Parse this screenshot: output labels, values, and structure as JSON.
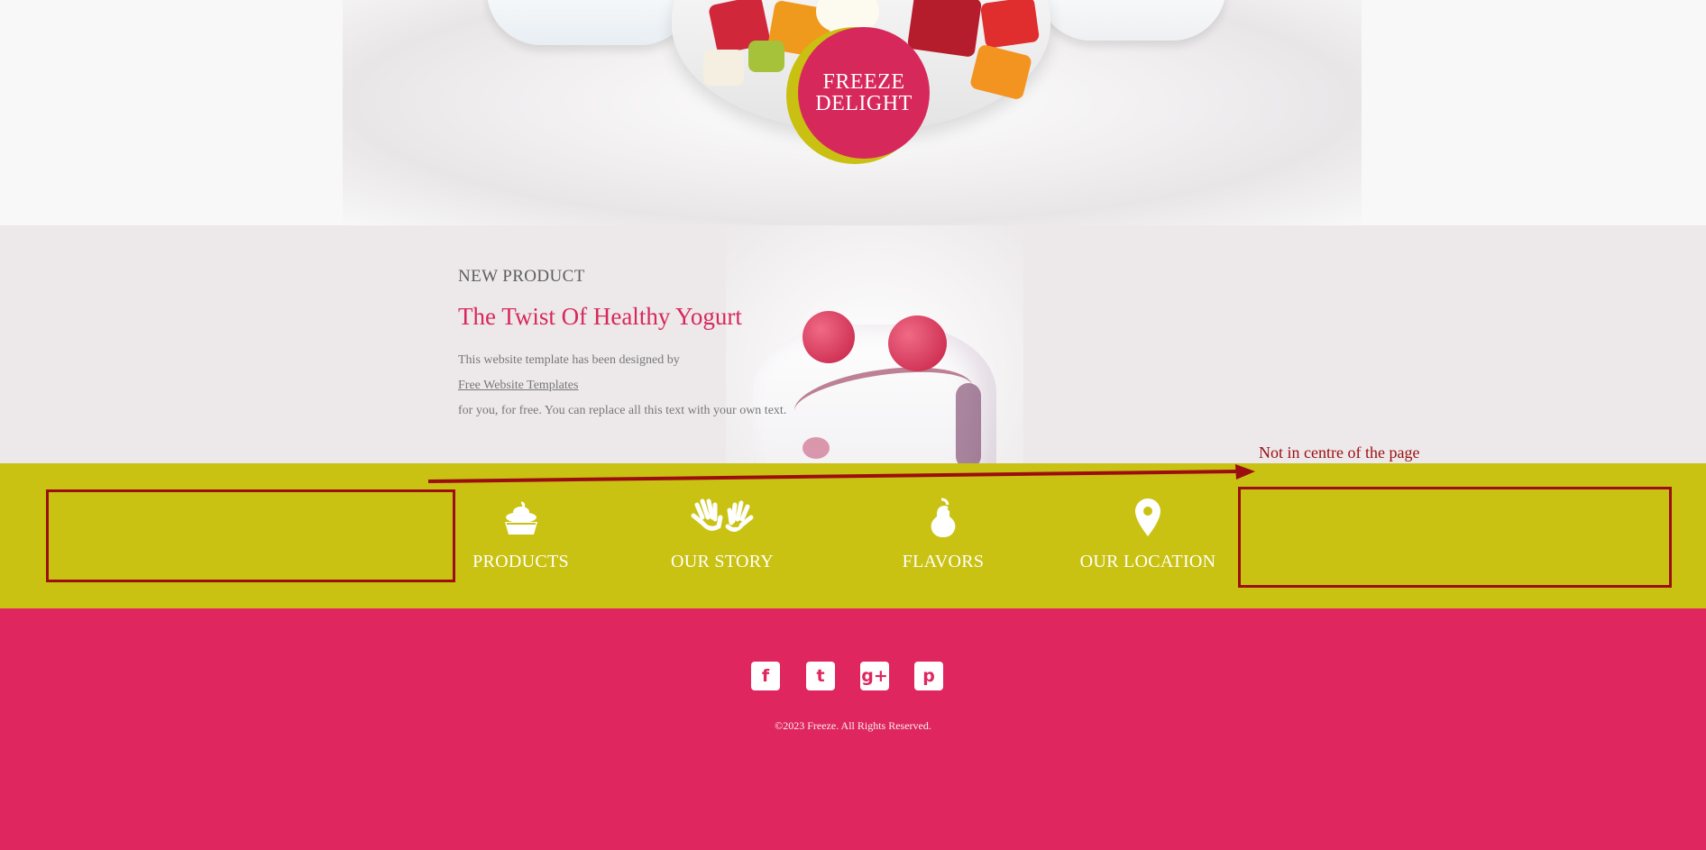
{
  "hero": {
    "logo_line1": "FREEZE",
    "logo_line2": "DELIGHT"
  },
  "new_product": {
    "kicker": "NEW PRODUCT",
    "title": "The Twist Of Healthy Yogurt",
    "text_1": "This website template has been designed by",
    "link": "Free Website Templates",
    "text_2": "for you, for free. You can replace all this text with your own text."
  },
  "nav": {
    "items": [
      {
        "label": "PRODUCTS",
        "icon": "cupcake-icon"
      },
      {
        "label": "OUR STORY",
        "icon": "hands-icon"
      },
      {
        "label": "FLAVORS",
        "icon": "pear-icon"
      },
      {
        "label": "OUR LOCATION",
        "icon": "location-pin-icon"
      }
    ]
  },
  "annotation": {
    "note": "Not in centre of the page",
    "color": "#9b0e12"
  },
  "footer": {
    "social": [
      {
        "name": "facebook-icon",
        "glyph": "f"
      },
      {
        "name": "twitter-icon",
        "glyph": "t"
      },
      {
        "name": "google-plus-icon",
        "glyph": "g+"
      },
      {
        "name": "pinterest-icon",
        "glyph": "p"
      }
    ],
    "copyright": "©2023 Freeze. All Rights Reserved."
  },
  "colors": {
    "brand_pink": "#e0265e",
    "brand_lime": "#c9c212",
    "logo_pink": "#d7285c"
  }
}
